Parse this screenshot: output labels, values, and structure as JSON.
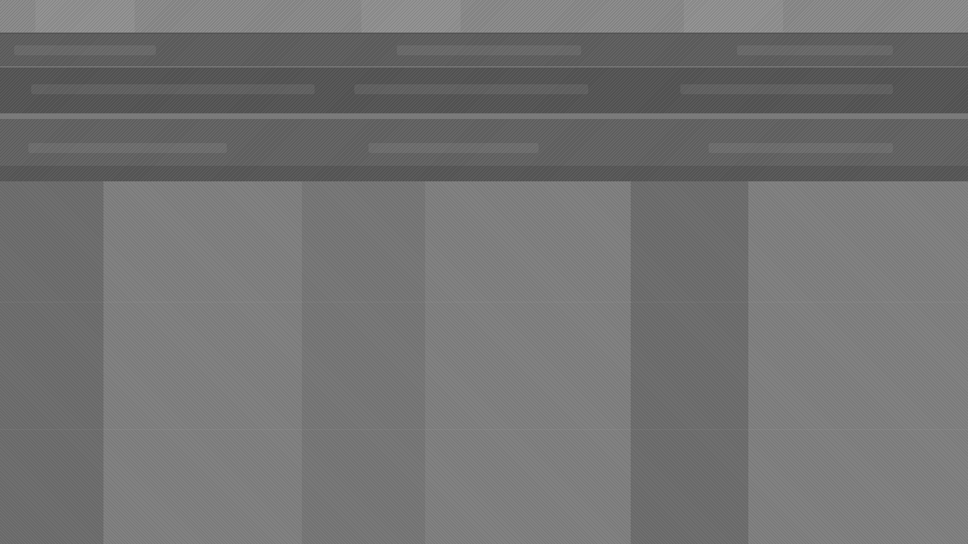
{
  "screen": {
    "description_visible_text": "",
    "colors": {
      "background": "#737373",
      "top_strip": "#8b8b8b",
      "header_bar": "#626262",
      "toolbar_bar": "#5a5a5a",
      "sub_bar": "#666666"
    },
    "regions": [
      "top-strip",
      "header-bar",
      "toolbar-bar",
      "sub-bar",
      "content-area"
    ]
  }
}
